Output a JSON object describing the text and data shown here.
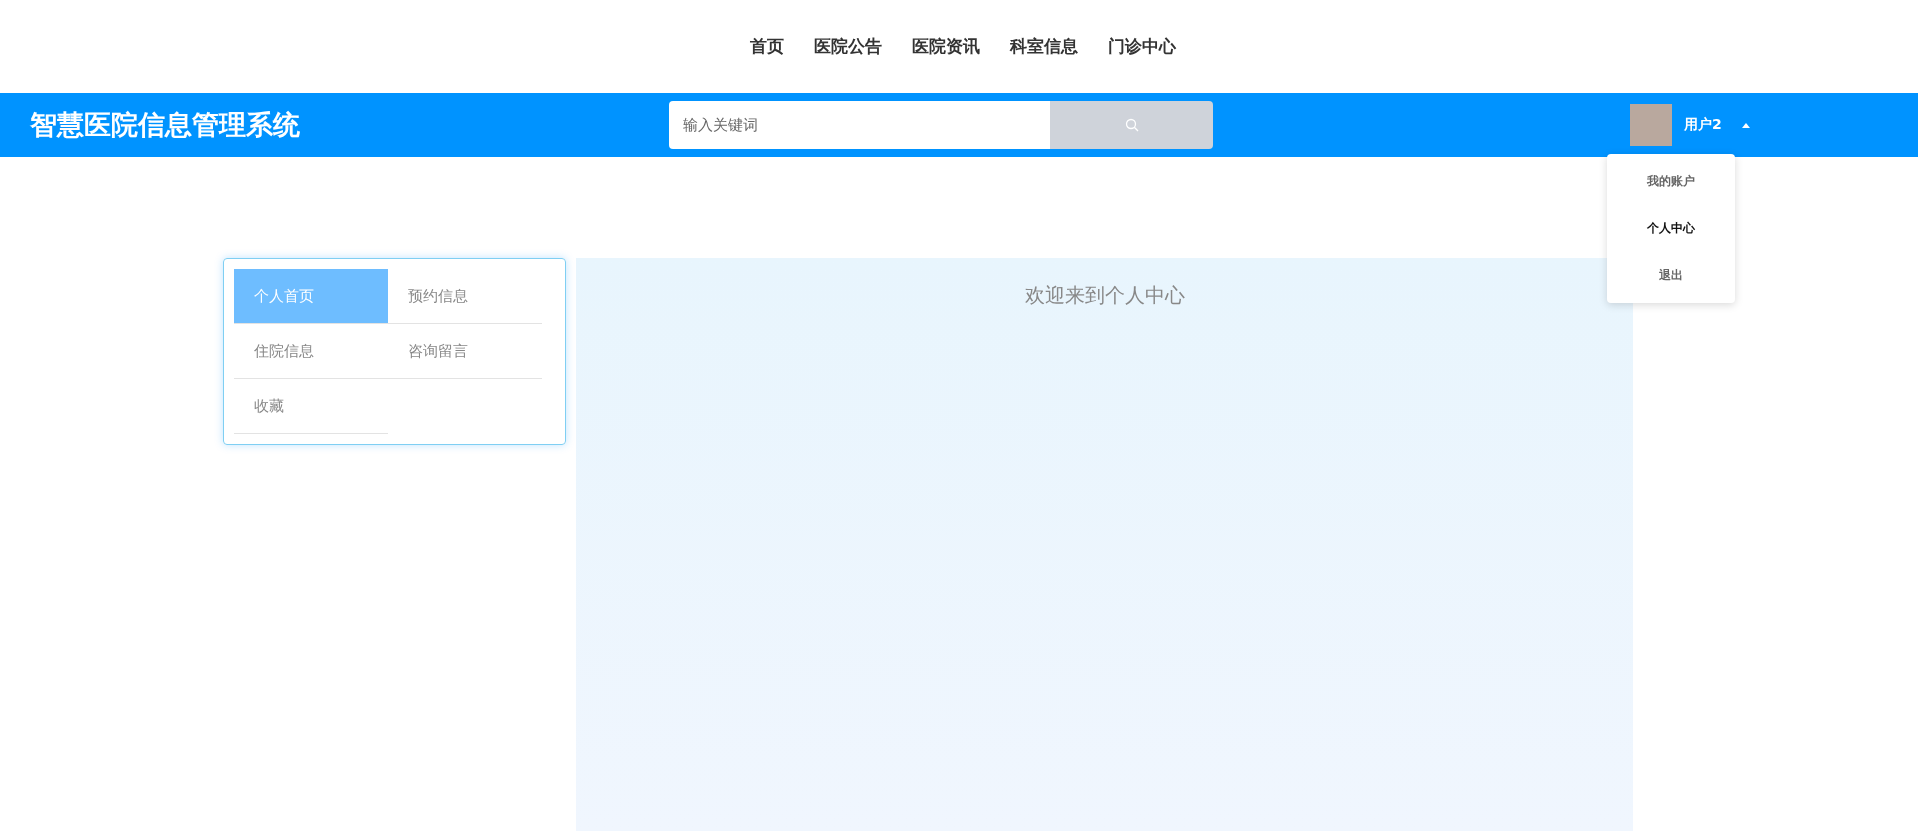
{
  "top_nav": [
    {
      "label": "首页"
    },
    {
      "label": "医院公告"
    },
    {
      "label": "医院资讯"
    },
    {
      "label": "科室信息"
    },
    {
      "label": "门诊中心"
    }
  ],
  "header": {
    "title": "智慧医院信息管理系统",
    "search": {
      "placeholder": "输入关键词"
    },
    "user": {
      "name": "用户2",
      "menu_open": true
    }
  },
  "user_menu": [
    {
      "label": "我的账户",
      "selected": false
    },
    {
      "label": "个人中心",
      "selected": true
    },
    {
      "label": "退出",
      "selected": false
    }
  ],
  "side_menu": [
    {
      "label": "个人首页",
      "selected": true
    },
    {
      "label": "预约信息",
      "selected": false
    },
    {
      "label": "住院信息",
      "selected": false
    },
    {
      "label": "咨询留言",
      "selected": false
    },
    {
      "label": "收藏",
      "selected": false
    }
  ],
  "main": {
    "heading": "欢迎来到个人中心"
  }
}
